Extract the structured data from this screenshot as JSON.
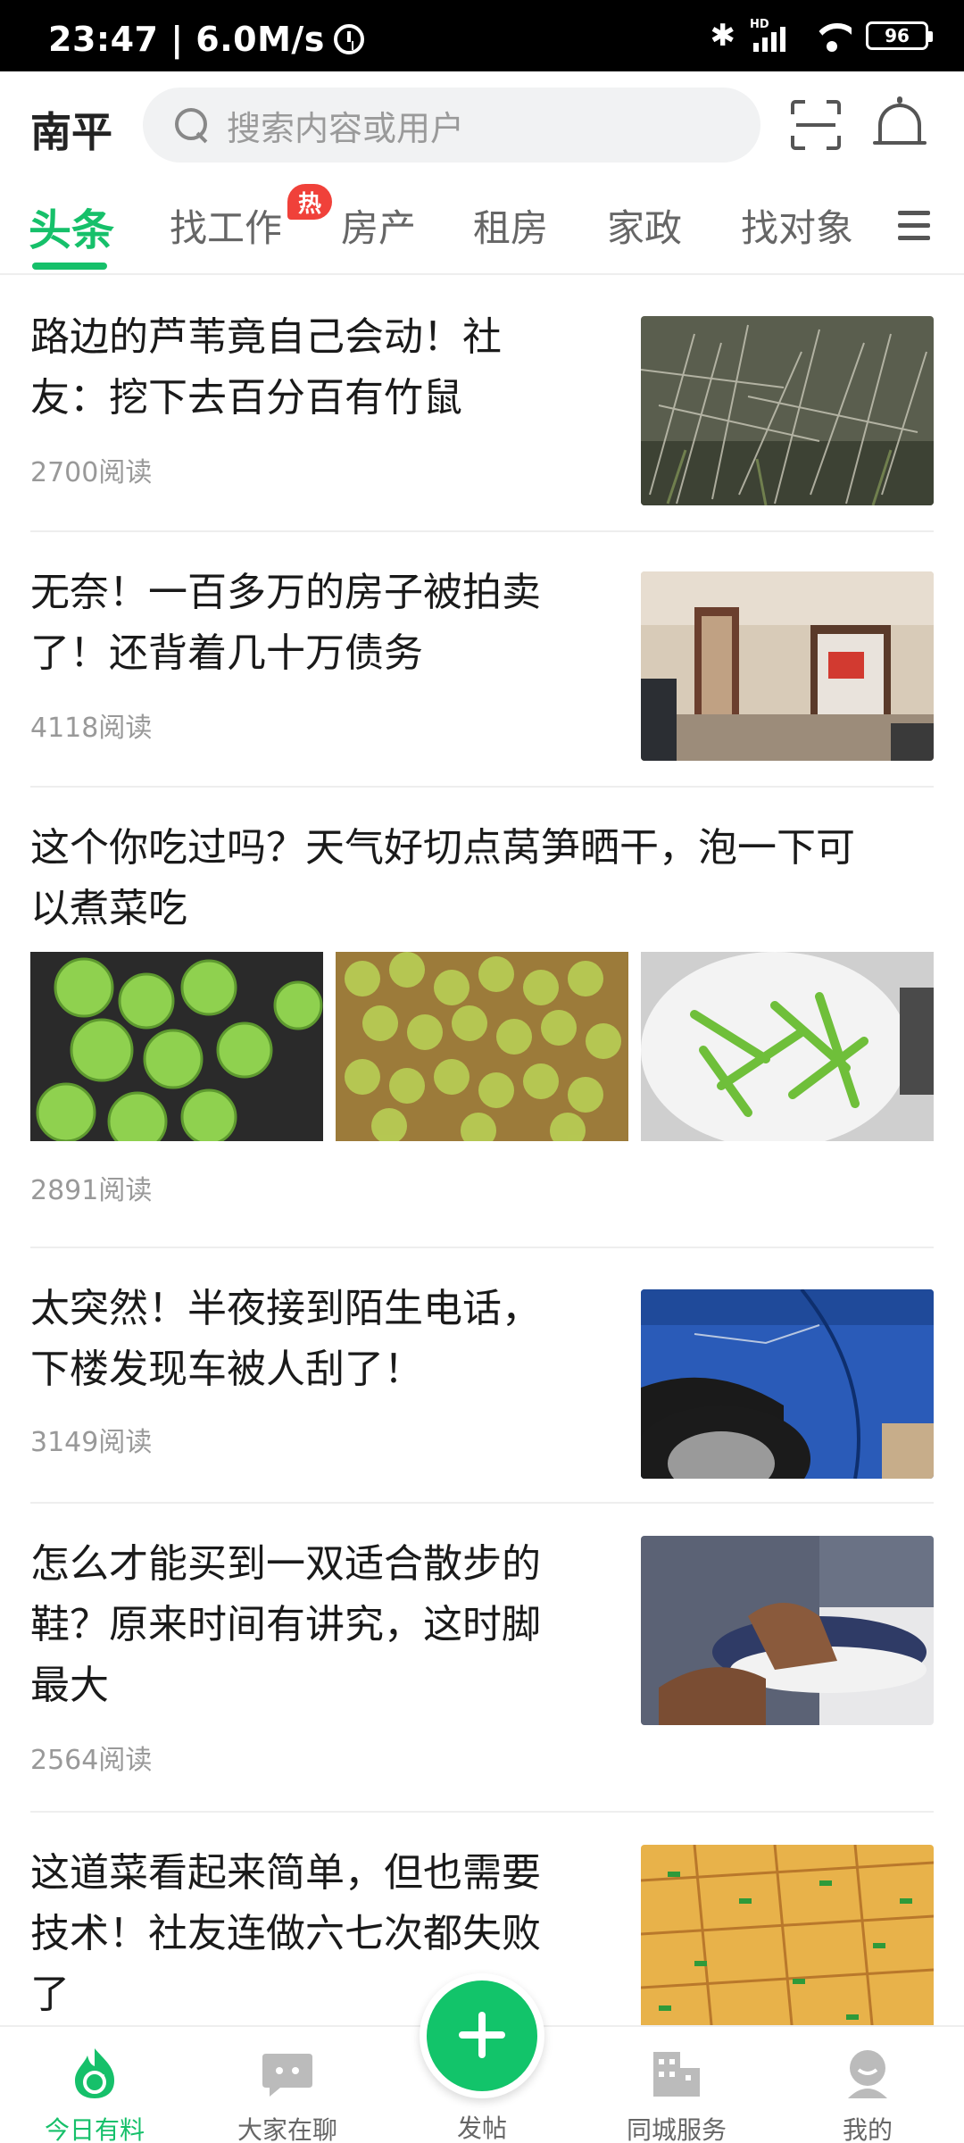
{
  "status_bar": {
    "time_speed": "23:47 | 6.0M/s",
    "signal_label": "HD",
    "battery": "96"
  },
  "header": {
    "city": "南平",
    "search_placeholder": "搜索内容或用户"
  },
  "tabs": [
    {
      "label": "头条"
    },
    {
      "label": "找工作",
      "badge": "热"
    },
    {
      "label": "房产"
    },
    {
      "label": "租房"
    },
    {
      "label": "家政"
    },
    {
      "label": "找对象"
    }
  ],
  "articles": [
    {
      "title_lines": [
        "路边的芦苇竟自己会动！社",
        "友：挖下去百分百有竹鼠"
      ],
      "reads": "2700阅读"
    },
    {
      "title_lines": [
        "无奈！一百多万的房子被拍卖",
        "了！还背着几十万债务"
      ],
      "reads": "4118阅读"
    },
    {
      "title_lines": [
        "这个你吃过吗？天气好切点莴笋晒干，泡一下可",
        "以煮菜吃"
      ],
      "reads": "2891阅读"
    },
    {
      "title_lines": [
        "太突然！半夜接到陌生电话，",
        "下楼发现车被人刮了！"
      ],
      "reads": "3149阅读"
    },
    {
      "title_lines": [
        "怎么才能买到一双适合散步的",
        "鞋？原来时间有讲究，这时脚",
        "最大"
      ],
      "reads": "2564阅读"
    },
    {
      "title_lines": [
        "这道菜看起来简单，但也需要",
        "技术！社友连做六七次都失败",
        "了"
      ],
      "reads": ""
    }
  ],
  "bottom_nav": {
    "items": [
      {
        "label": "今日有料"
      },
      {
        "label": "大家在聊"
      },
      {
        "label": "发帖"
      },
      {
        "label": "同城服务"
      },
      {
        "label": "我的"
      }
    ]
  },
  "colors": {
    "accent": "#16c06a",
    "hot": "#f0413a"
  }
}
